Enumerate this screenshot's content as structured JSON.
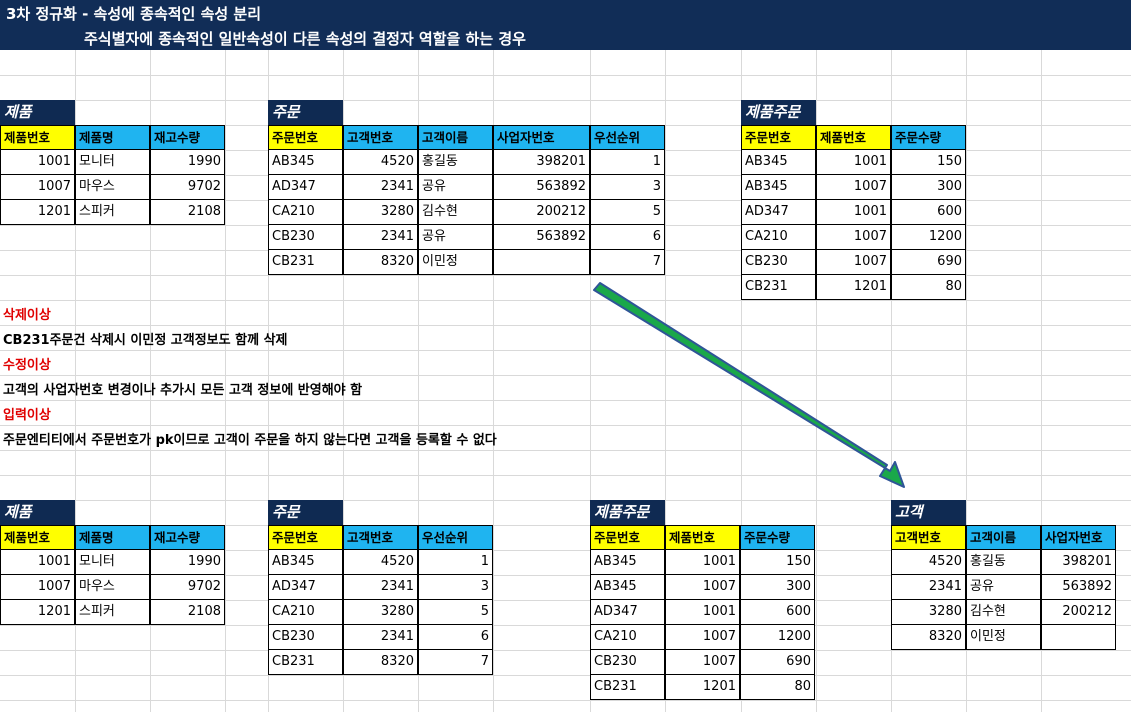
{
  "banner": {
    "title": "3차 정규화 - 속성에 종속적인 속성 분리",
    "subtitle": "주식별자에 종속적인 일반속성이 다른 속성의 결정자 역할을 하는 경우"
  },
  "top": {
    "product": {
      "title": "제품",
      "headers": [
        "제품번호",
        "제품명",
        "재고수량"
      ],
      "rows": [
        [
          "1001",
          "모니터",
          "1990"
        ],
        [
          "1007",
          "마우스",
          "9702"
        ],
        [
          "1201",
          "스피커",
          "2108"
        ]
      ]
    },
    "order": {
      "title": "주문",
      "headers": [
        "주문번호",
        "고객번호",
        "고객이름",
        "사업자번호",
        "우선순위"
      ],
      "rows": [
        [
          "AB345",
          "4520",
          "홍길동",
          "398201",
          "1"
        ],
        [
          "AD347",
          "2341",
          "공유",
          "563892",
          "3"
        ],
        [
          "CA210",
          "3280",
          "김수현",
          "200212",
          "5"
        ],
        [
          "CB230",
          "2341",
          "공유",
          "563892",
          "6"
        ],
        [
          "CB231",
          "8320",
          "이민정",
          "",
          "7"
        ]
      ]
    },
    "product_order": {
      "title": "제품주문",
      "headers": [
        "주문번호",
        "제품번호",
        "주문수량"
      ],
      "rows": [
        [
          "AB345",
          "1001",
          "150"
        ],
        [
          "AB345",
          "1007",
          "300"
        ],
        [
          "AD347",
          "1001",
          "600"
        ],
        [
          "CA210",
          "1007",
          "1200"
        ],
        [
          "CB230",
          "1007",
          "690"
        ],
        [
          "CB231",
          "1201",
          "80"
        ]
      ]
    }
  },
  "notes": {
    "delete_label": "삭제이상",
    "delete_text": " CB231주문건 삭제시 이민정 고객정보도 함께 삭제",
    "update_label": "수정이상",
    "update_text": "고객의 사업자번호 변경이나 추가시 모든 고객 정보에 반영해야 함",
    "insert_label": "입력이상",
    "insert_text": "주문엔티티에서 주문번호가 pk이므로 고객이 주문을 하지 않는다면 고객을 등록할 수 없다"
  },
  "bottom": {
    "product": {
      "title": "제품",
      "headers": [
        "제품번호",
        "제품명",
        "재고수량"
      ],
      "rows": [
        [
          "1001",
          "모니터",
          "1990"
        ],
        [
          "1007",
          "마우스",
          "9702"
        ],
        [
          "1201",
          "스피커",
          "2108"
        ]
      ]
    },
    "order": {
      "title": "주문",
      "headers": [
        "주문번호",
        "고객번호",
        "우선순위"
      ],
      "rows": [
        [
          "AB345",
          "4520",
          "1"
        ],
        [
          "AD347",
          "2341",
          "3"
        ],
        [
          "CA210",
          "3280",
          "5"
        ],
        [
          "CB230",
          "2341",
          "6"
        ],
        [
          "CB231",
          "8320",
          "7"
        ]
      ]
    },
    "product_order": {
      "title": "제품주문",
      "headers": [
        "주문번호",
        "제품번호",
        "주문수량"
      ],
      "rows": [
        [
          "AB345",
          "1001",
          "150"
        ],
        [
          "AB345",
          "1007",
          "300"
        ],
        [
          "AD347",
          "1001",
          "600"
        ],
        [
          "CA210",
          "1007",
          "1200"
        ],
        [
          "CB230",
          "1007",
          "690"
        ],
        [
          "CB231",
          "1201",
          "80"
        ]
      ]
    },
    "customer": {
      "title": "고객",
      "headers": [
        "고객번호",
        "고객이름",
        "사업자번호"
      ],
      "rows": [
        [
          "4520",
          "홍길동",
          "398201"
        ],
        [
          "2341",
          "공유",
          "563892"
        ],
        [
          "3280",
          "김수현",
          "200212"
        ],
        [
          "8320",
          "이민정",
          ""
        ]
      ]
    }
  },
  "colors": {
    "banner_bg": "#112d57",
    "key_header": "#ffff00",
    "attr_header": "#1fb4f0",
    "anomaly_label": "#e00000",
    "arrow": "#1aa84a"
  },
  "icons": {
    "transform_arrow": "arrow-icon"
  }
}
